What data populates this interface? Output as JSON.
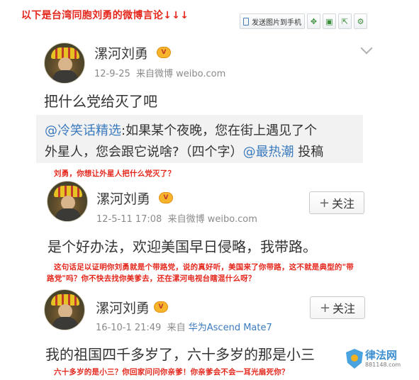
{
  "header": {
    "caption": "以下是台湾同胞刘勇的微博言论↓↓↓"
  },
  "toolbar": {
    "send_label": "发送图片到手机",
    "icons": [
      "phone-icon",
      "expand-icon",
      "save-icon",
      "share-icon",
      "settings-icon"
    ]
  },
  "posts": [
    {
      "author": "漯河刘勇",
      "vip_badge": "V",
      "date": "12-9-25",
      "source_prefix": "来自微博",
      "source": "weibo.com",
      "content": "把什么党给灭了吧",
      "quote": {
        "mention1": "@冷笑话精选",
        "line1_rest": ":如果某个夜晚，您在街上遇见了个",
        "line2_start": "外星人，您会跟它说啥?（四个字）",
        "mention2": "@最热潮",
        "line2_end": " 投稿"
      }
    },
    {
      "author": "漯河刘勇",
      "vip_badge": "V",
      "date": "12-5-11 17:08",
      "source_prefix": "来自微博",
      "source": "weibo.com",
      "follow_plus": "+",
      "follow_label": "关注",
      "content": "是个好办法，欢迎美国早日侵略，我带路。"
    },
    {
      "author": "漯河刘勇",
      "vip_badge": "V",
      "date": "16-10-1 21:49",
      "source_prefix": "来自",
      "source": "华为Ascend Mate7",
      "follow_plus": "+",
      "follow_label": "关注",
      "content": "我的祖国四千多岁了，六十多岁的那是小三"
    }
  ],
  "notes": {
    "note1": "刘勇，你想让外星人把什么党灭了？",
    "note2_line1": "这句话足以证明你刘勇就是个带路党，说的真好听，美国来了你带路，这不就是典型的\"带",
    "note2_line2": "路党\"吗？你不快去找你美爹去，还在漯河电视台瞎混什么呀？",
    "note3": "六十多岁的是小三？你回家问问你亲爹！你亲爹会不会一耳光扇死你？"
  },
  "watermark": {
    "name": "律法网",
    "url": "881148.com"
  },
  "colors": {
    "note_red": "#e5281d",
    "link_blue": "#3b7bbf",
    "vip_gold": "#f7b52b"
  }
}
